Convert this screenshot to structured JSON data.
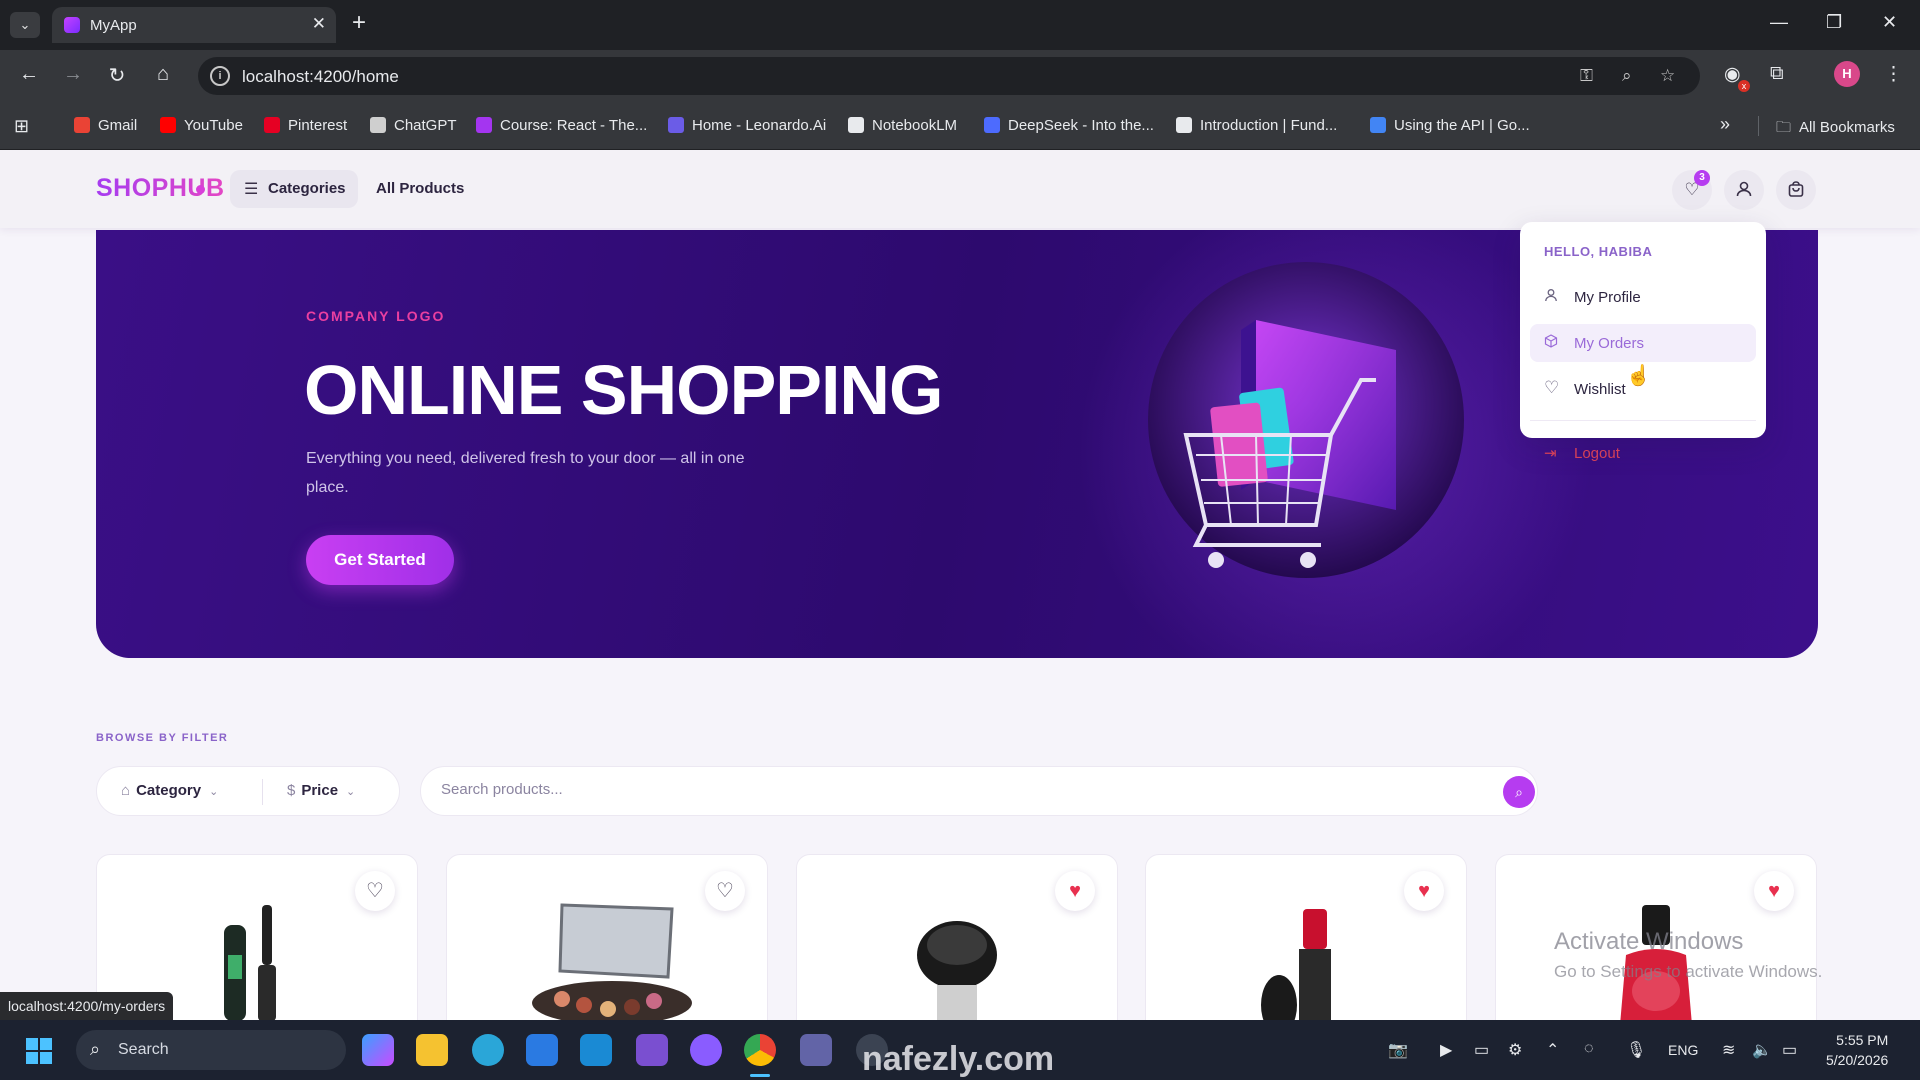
{
  "browser": {
    "tab_title": "MyApp",
    "url": "localhost:4200/home",
    "bookmarks": [
      {
        "label": "Gmail",
        "color": "#ea4335"
      },
      {
        "label": "YouTube",
        "color": "#ff0000"
      },
      {
        "label": "Pinterest",
        "color": "#e60023"
      },
      {
        "label": "ChatGPT",
        "color": "#cfcfcf"
      },
      {
        "label": "Course: React - The...",
        "color": "#a435f0"
      },
      {
        "label": "Home - Leonardo.Ai",
        "color": "#6b5ce7"
      },
      {
        "label": "NotebookLM",
        "color": "#e8eaed"
      },
      {
        "label": "DeepSeek - Into the...",
        "color": "#4d6bfe"
      },
      {
        "label": "Introduction | Fund...",
        "color": "#e8eaed"
      },
      {
        "label": "Using the API | Go...",
        "color": "#4285f4"
      }
    ],
    "all_bookmarks": "All Bookmarks",
    "profile_initial": "H",
    "status_url": "localhost:4200/my-orders"
  },
  "header": {
    "logo": "SHOPHUB",
    "categories_label": "Categories",
    "all_products_label": "All Products",
    "wishlist_count": "3"
  },
  "hero": {
    "kicker": "COMPANY LOGO",
    "title": "ONLINE SHOPPING",
    "subtitle": "Everything you need, delivered fresh to your door — all in one place.",
    "cta": "Get Started"
  },
  "filters": {
    "section_label": "BROWSE BY FILTER",
    "category_label": "Category",
    "price_label": "Price",
    "search_placeholder": "Search products..."
  },
  "products": [
    {
      "product": "mascara",
      "wishlisted": false
    },
    {
      "product": "eyeshadow palette",
      "wishlisted": false
    },
    {
      "product": "compact powder",
      "wishlisted": true
    },
    {
      "product": "lipstick",
      "wishlisted": true
    },
    {
      "product": "nail polish",
      "wishlisted": true
    }
  ],
  "user_menu": {
    "greeting": "HELLO, HABIBA",
    "items": [
      {
        "label": "My Profile",
        "icon": "user-icon"
      },
      {
        "label": "My Orders",
        "icon": "box-icon"
      },
      {
        "label": "Wishlist",
        "icon": "heart-icon"
      }
    ],
    "logout": "Logout"
  },
  "overlay": {
    "activate_title": "Activate Windows",
    "activate_sub": "Go to Settings to activate Windows.",
    "watermark": "nafezly.com"
  },
  "taskbar": {
    "search_label": "Search",
    "language": "ENG",
    "time": "5:55 PM",
    "date": "5/20/2026"
  },
  "colors": {
    "accent": "#b63cf0",
    "hero_bg": "#2d0a6e",
    "heart_active": "#e8304f"
  }
}
